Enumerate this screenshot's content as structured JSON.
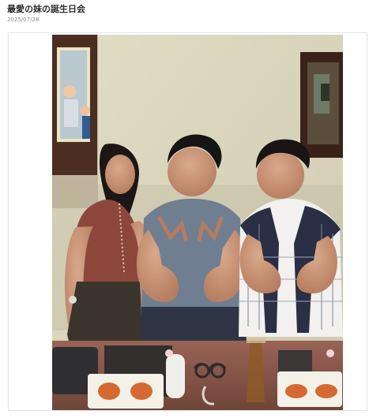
{
  "post": {
    "title": "最愛の妹の誕生日会",
    "date": "2025/07/28"
  },
  "photo": {
    "icon": "photo-icon",
    "colors": {
      "wall": "#d9d5bd",
      "table": "#8b5b50",
      "frame": "#4a2d22",
      "shirt_gray": "#6f7f91",
      "top_brown": "#8d473a",
      "sauce": "#d46a32"
    }
  }
}
